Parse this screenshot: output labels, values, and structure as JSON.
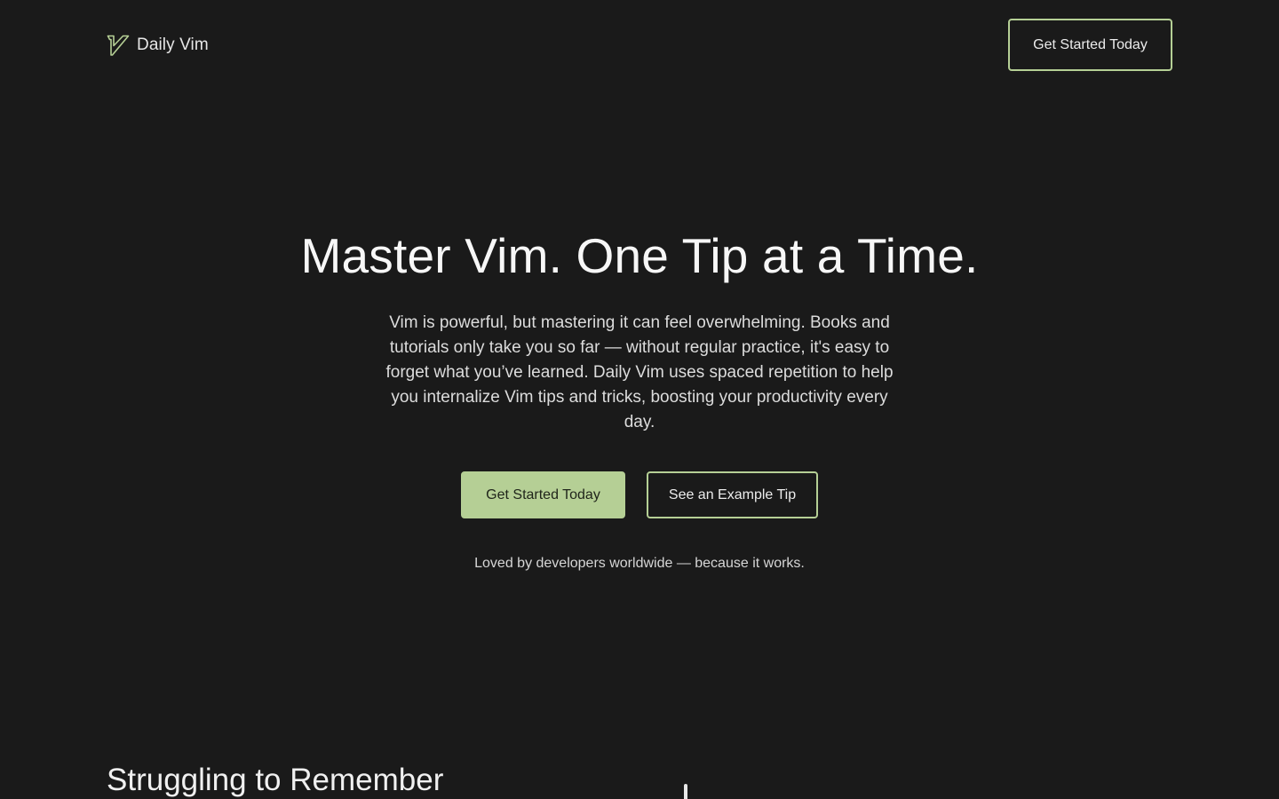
{
  "brand": {
    "name": "Daily Vim",
    "icon": "vim-v-logo-icon"
  },
  "nav": {
    "cta_label": "Get Started Today"
  },
  "hero": {
    "title": "Master Vim. One Tip at a Time.",
    "subtitle": "Vim is powerful, but mastering it can feel overwhelming. Books and tutorials only take you so far — without regular practice, it's easy to forget what you’ve learned. Daily Vim uses spaced repetition to help you internalize Vim tips and tricks, boosting your productivity every day.",
    "primary_cta": "Get Started Today",
    "secondary_cta": "See an Example Tip",
    "social_proof": "Loved by developers worldwide — because it works."
  },
  "section": {
    "title": "Struggling to Remember"
  },
  "colors": {
    "background": "#1a1a1a",
    "accent": "#b5cf95",
    "text": "#f0f0f0"
  }
}
